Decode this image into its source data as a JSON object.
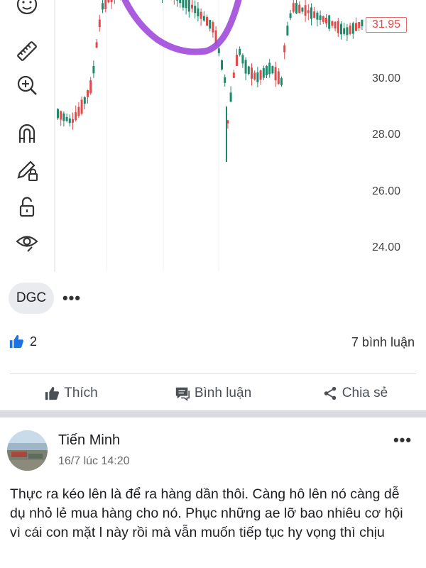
{
  "chart": {
    "price_labels": [
      "30.00",
      "28.00",
      "26.00",
      "24.00"
    ],
    "current_price": "31.95",
    "up_color": "#1e8a6c",
    "down_color": "#e14b4b",
    "annotation_color": "#9b3fd8",
    "tools": [
      "smiley-icon",
      "ruler-icon",
      "zoom-in-icon",
      "magnet-icon",
      "pencil-lock-icon",
      "unlock-icon",
      "eye-icon"
    ]
  },
  "post": {
    "ticker_chip": "DGC",
    "like_count": "2",
    "comments_count": "7 bình luận",
    "actions": {
      "like": "Thích",
      "comment": "Bình luận",
      "share": "Chia sẻ"
    }
  },
  "comment": {
    "author": "Tiến Minh",
    "timestamp": "16/7 lúc 14:20",
    "text": "Thực ra kéo lên là để ra hàng dần thôi. Càng hô lên nó càng dễ dụ nhỏ lẻ mua hàng cho nó. Phục những ae lỡ bao nhiêu cơ hội vì cái con mặt l này rồi mà vẫn muốn tiếp tục hy vọng thì chịu"
  }
}
